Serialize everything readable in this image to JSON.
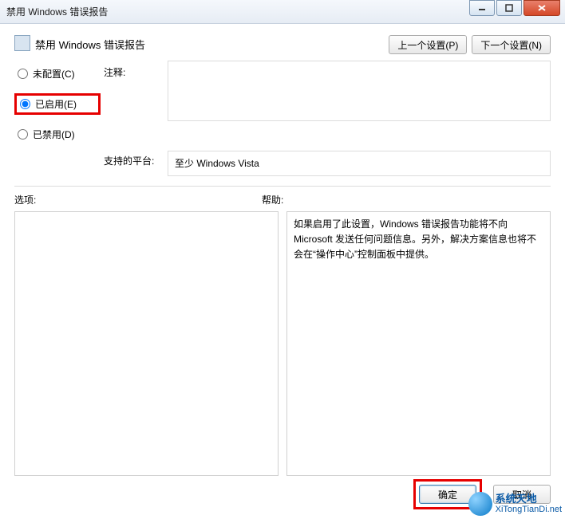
{
  "window": {
    "title": "禁用 Windows 错误报告"
  },
  "header": {
    "title": "禁用 Windows 错误报告",
    "prev_button": "上一个设置(P)",
    "next_button": "下一个设置(N)"
  },
  "radios": {
    "not_configured": "未配置(C)",
    "enabled": "已启用(E)",
    "disabled": "已禁用(D)",
    "selected": "enabled"
  },
  "labels": {
    "comment": "注释:",
    "platform": "支持的平台:",
    "options": "选项:",
    "help": "帮助:"
  },
  "comment_value": "",
  "platform_value": "至少 Windows Vista",
  "help_text": "如果启用了此设置，Windows 错误报告功能将不向 Microsoft 发送任何问题信息。另外，解决方案信息也将不会在“操作中心”控制面板中提供。",
  "buttons": {
    "ok": "确定",
    "cancel": "取消"
  },
  "watermark": {
    "line1": "系统天地",
    "line2": "XiTongTianDi.net"
  }
}
